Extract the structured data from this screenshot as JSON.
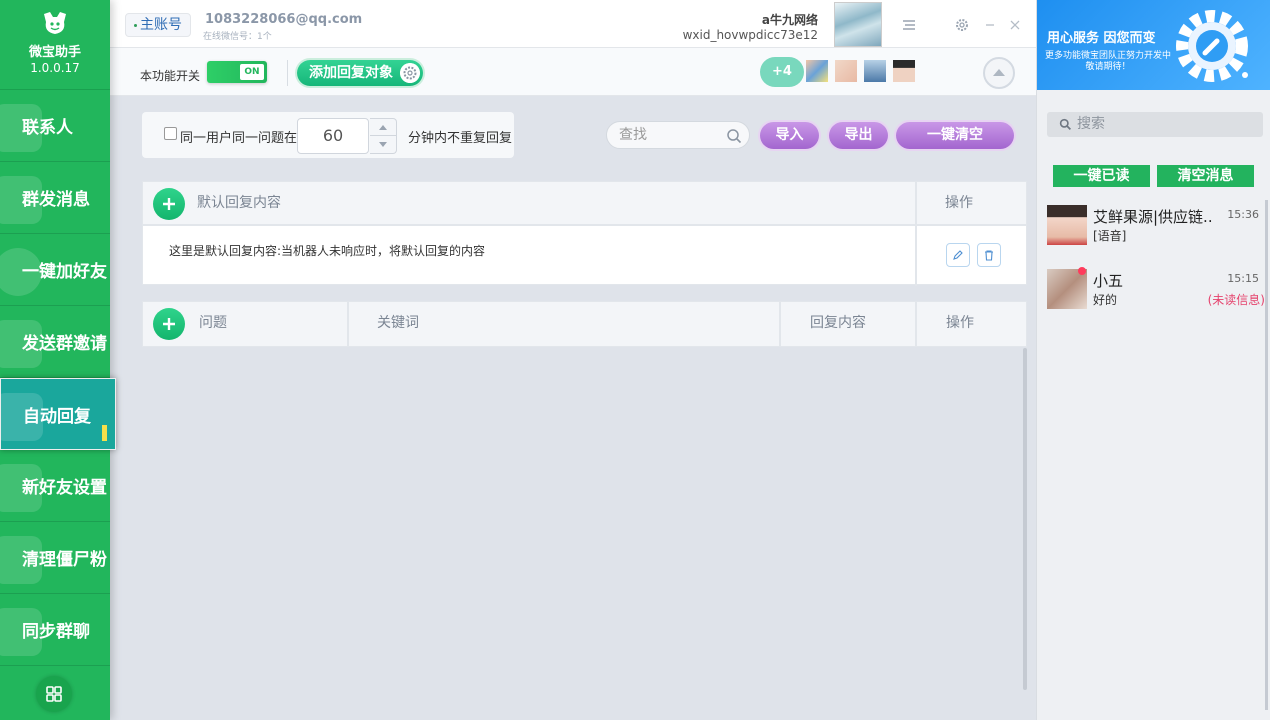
{
  "app": {
    "name": "微宝助手",
    "version": "1.0.0.17"
  },
  "sidebar": {
    "items": [
      {
        "label": "联系人"
      },
      {
        "label": "群发消息"
      },
      {
        "label": "一键加好友"
      },
      {
        "label": "发送群邀请"
      },
      {
        "label": "自动回复"
      },
      {
        "label": "新好友设置"
      },
      {
        "label": "清理僵尸粉"
      },
      {
        "label": "同步群聊"
      }
    ],
    "active": "自动回复"
  },
  "header": {
    "account_tab": "主账号",
    "email": "1083228066@qq.com",
    "online_sub": "在线微信号：1个",
    "wx_name": "a牛九网络",
    "wx_id": "wxid_hovwpdicc73e12"
  },
  "toolbar": {
    "func_switch_label": "本功能开关",
    "toggle_state": "ON",
    "add_target_label": "添加回复对象",
    "more_count": "+4"
  },
  "settings": {
    "checkbox_label": "同一用户同一问题在",
    "minutes": "60",
    "suffix_label": "分钟内不重复回复",
    "search_placeholder": "查找",
    "import_label": "导入",
    "export_label": "导出",
    "clear_all_label": "一键清空"
  },
  "default_table": {
    "header": "默认回复内容",
    "action_header": "操作",
    "row_text": "这里是默认回复内容:当机器人未响应时，将默认回复的内容"
  },
  "rules_table": {
    "columns": [
      "问题",
      "关键词",
      "回复内容",
      "操作"
    ]
  },
  "right_panel": {
    "banner_title": "用心服务 因您而变",
    "banner_sub1": "更多功能微宝团队正努力开发中",
    "banner_sub2": "敬请期待！",
    "search_placeholder": "搜索",
    "read_all_label": "一键已读",
    "clear_msgs_label": "清空消息",
    "messages": [
      {
        "name": "艾鲜果源|供应链..",
        "time": "15:36",
        "preview": "[语音]",
        "status": ""
      },
      {
        "name": "小五",
        "time": "15:15",
        "preview": "好的",
        "status": "(未读信息)"
      }
    ]
  },
  "colors": {
    "brand_green": "#22b65c",
    "active_teal": "#1aa79c",
    "purple_btn": "#b47dd9",
    "unread_red": "#e5436d"
  }
}
